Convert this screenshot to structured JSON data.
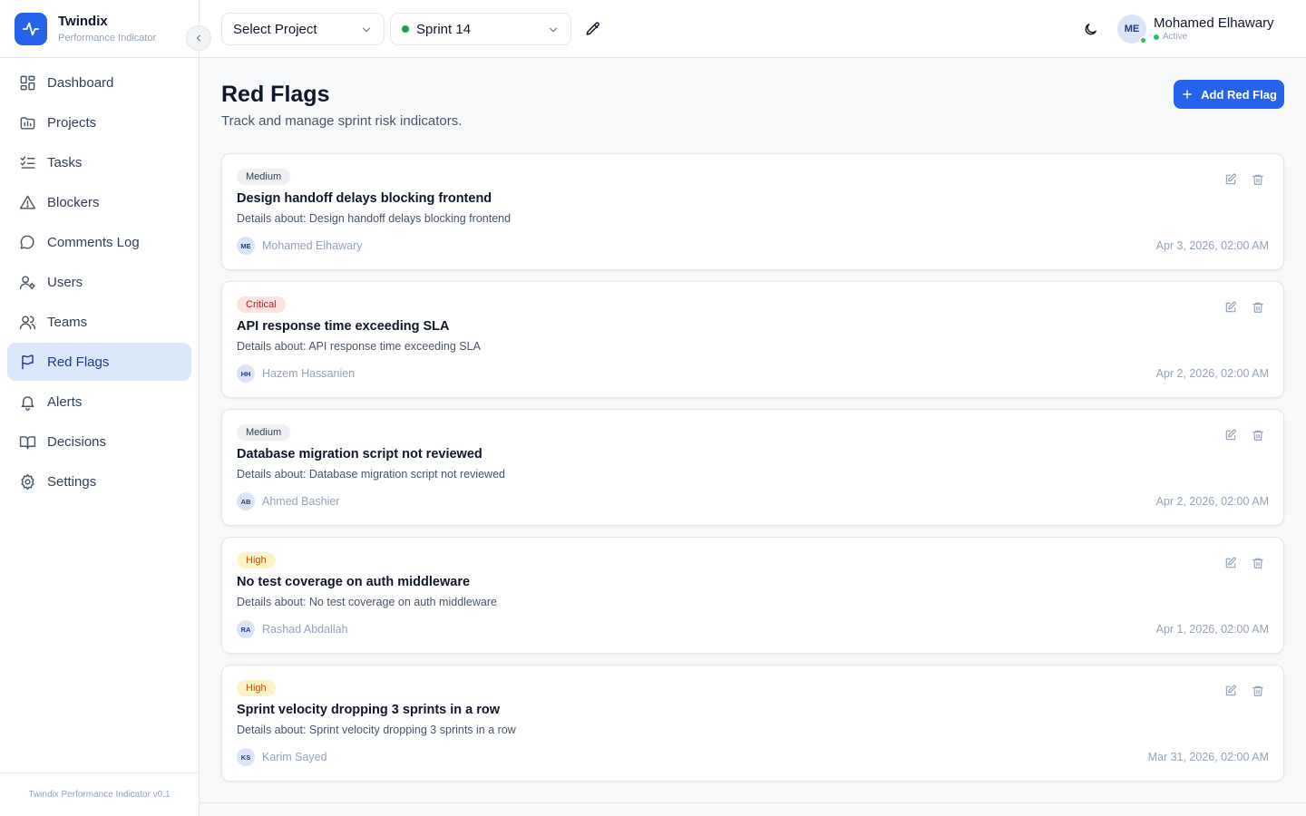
{
  "brand": {
    "name": "Twindix",
    "subtitle": "Performance Indicator"
  },
  "sidebar": {
    "items": [
      {
        "label": "Dashboard",
        "icon": "dashboard-icon"
      },
      {
        "label": "Projects",
        "icon": "projects-icon"
      },
      {
        "label": "Tasks",
        "icon": "tasks-icon"
      },
      {
        "label": "Blockers",
        "icon": "alert-triangle-icon"
      },
      {
        "label": "Comments Log",
        "icon": "comment-icon"
      },
      {
        "label": "Users",
        "icon": "user-settings-icon"
      },
      {
        "label": "Teams",
        "icon": "users-icon"
      },
      {
        "label": "Red Flags",
        "icon": "flag-icon",
        "active": true
      },
      {
        "label": "Alerts",
        "icon": "bell-icon"
      },
      {
        "label": "Decisions",
        "icon": "book-icon"
      },
      {
        "label": "Settings",
        "icon": "gear-icon"
      }
    ],
    "footer": "Twindix Performance Indicator v0.1"
  },
  "header": {
    "project_select": "Select Project",
    "sprint_select": "Sprint 14",
    "user": {
      "initials": "ME",
      "name": "Mohamed Elhawary",
      "status": "Active"
    }
  },
  "main": {
    "title": "Red Flags",
    "subtitle": "Track and manage sprint risk indicators.",
    "add_button": "Add Red Flag"
  },
  "flags": [
    {
      "severity": "Medium",
      "level": "medium",
      "title": "Design handoff delays blocking frontend",
      "details": "Details about: Design handoff delays blocking frontend",
      "initials": "ME",
      "author": "Mohamed Elhawary",
      "date": "Apr 3, 2026, 02:00 AM"
    },
    {
      "severity": "Critical",
      "level": "critical",
      "title": "API response time exceeding SLA",
      "details": "Details about: API response time exceeding SLA",
      "initials": "HH",
      "author": "Hazem Hassanien",
      "date": "Apr 2, 2026, 02:00 AM"
    },
    {
      "severity": "Medium",
      "level": "medium",
      "title": "Database migration script not reviewed",
      "details": "Details about: Database migration script not reviewed",
      "initials": "AB",
      "author": "Ahmed Bashier",
      "date": "Apr 2, 2026, 02:00 AM"
    },
    {
      "severity": "High",
      "level": "high",
      "title": "No test coverage on auth middleware",
      "details": "Details about: No test coverage on auth middleware",
      "initials": "RA",
      "author": "Rashad Abdallah",
      "date": "Apr 1, 2026, 02:00 AM"
    },
    {
      "severity": "High",
      "level": "high",
      "title": "Sprint velocity dropping 3 sprints in a row",
      "details": "Details about: Sprint velocity dropping 3 sprints in a row",
      "initials": "KS",
      "author": "Karim Sayed",
      "date": "Mar 31, 2026, 02:00 AM"
    }
  ]
}
